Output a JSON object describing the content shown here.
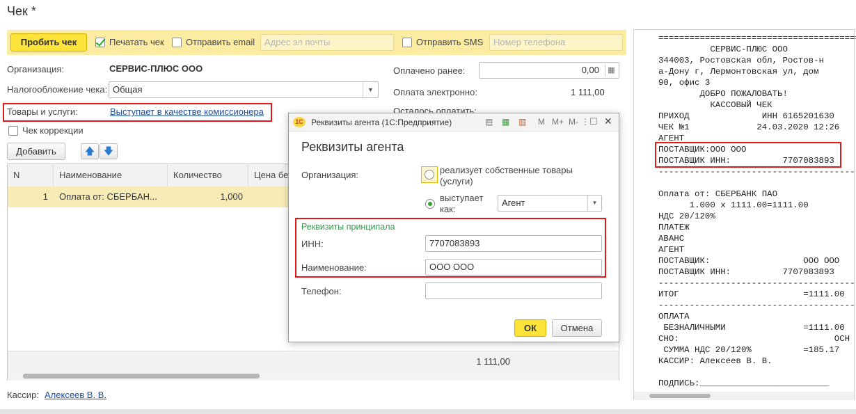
{
  "window_title": "Чек *",
  "toolbar": {
    "punch_label": "Пробить чек",
    "print_label": "Печатать чек",
    "email_label": "Отправить email",
    "email_placeholder": "Адрес эл почты",
    "sms_label": "Отправить SMS",
    "phone_placeholder": "Номер телефона"
  },
  "form": {
    "org_label": "Организация:",
    "org_value": "СЕРВИС-ПЛЮС ООО",
    "tax_label": "Налогообложение чека:",
    "tax_value": "Общая",
    "goods_label": "Товары и услуги:",
    "goods_link": "Выступает в качестве комиссионера",
    "correction_label": "Чек коррекции",
    "add_button": "Добавить",
    "paid_before_label": "Оплачено ранее:",
    "paid_before_value": "0,00",
    "paid_electronic_label": "Оплата электронно:",
    "paid_electronic_value": "1 111,00",
    "remaining_label": "Осталось оплатить:"
  },
  "table": {
    "headers": [
      "N",
      "Наименование",
      "Количество",
      "Цена бе"
    ],
    "rows": [
      {
        "n": "1",
        "name": "Оплата от: СБЕРБАН...",
        "qty": "1,000"
      }
    ],
    "footer_total": "1 111,00"
  },
  "cashier": {
    "label": "Кассир:",
    "name": "Алексеев В. В."
  },
  "dialog": {
    "title": "Реквизиты агента  (1С:Предприятие)",
    "icons": [
      "M",
      "M+",
      "M-"
    ],
    "heading": "Реквизиты агента",
    "org_label": "Организация:",
    "option_own": "реализует собственные товары (услуги)",
    "option_agent": "выступает как:",
    "agent_value": "Агент",
    "principal_heading": "Реквизиты принципала",
    "inn_label": "ИНН:",
    "inn_value": "7707083893",
    "name_label": "Наименование:",
    "name_value": "ООО ООО",
    "phone_label": "Телефон:",
    "ok_label": "ОК",
    "cancel_label": "Отмена"
  },
  "receipt": {
    "lines": [
      "===========================================",
      "          СЕРВИС-ПЛЮС ООО",
      "344003, Ростовская обл, Ростов-н",
      "а-Дону г, Лермонтовская ул, дом",
      "90, офис 3",
      "        ДОБРО ПОЖАЛОВАТЬ!",
      "          КАССОВЫЙ ЧЕК",
      "ПРИХОД              ИНН 6165201630",
      "ЧЕК №1             24.03.2020 12:26",
      "АГЕНТ",
      "ПОСТАВЩИК:ООО ООО",
      "ПОСТАВЩИК ИНН:          7707083893",
      "-------------------------------------------",
      "",
      "Оплата от: СБЕРБАНК ПАО",
      "      1.000 x 1111.00=1111.00",
      "НДС 20/120%",
      "ПЛАТЕЖ",
      "АВАНС",
      "АГЕНТ",
      "ПОСТАВЩИК:                  ООО ООО",
      "ПОСТАВЩИК ИНН:          7707083893",
      "-------------------------------------------",
      "ИТОГ                        =1111.00",
      "-------------------------------------------",
      "ОПЛАТА",
      " БЕЗНАЛИЧНЫМИ               =1111.00",
      "СНО:                              ОСН",
      " СУММА НДС 20/120%          =185.17",
      "КАССИР: Алексеев В. В.",
      "",
      "ПОДПИСЬ:_________________________"
    ]
  },
  "colors": {
    "accent_yellow": "#fde23a",
    "toolbar_bg": "#fbeca1",
    "highlight_red": "#e01919",
    "principal_green": "#2e9e4a",
    "link_blue": "#1f4e9c"
  }
}
